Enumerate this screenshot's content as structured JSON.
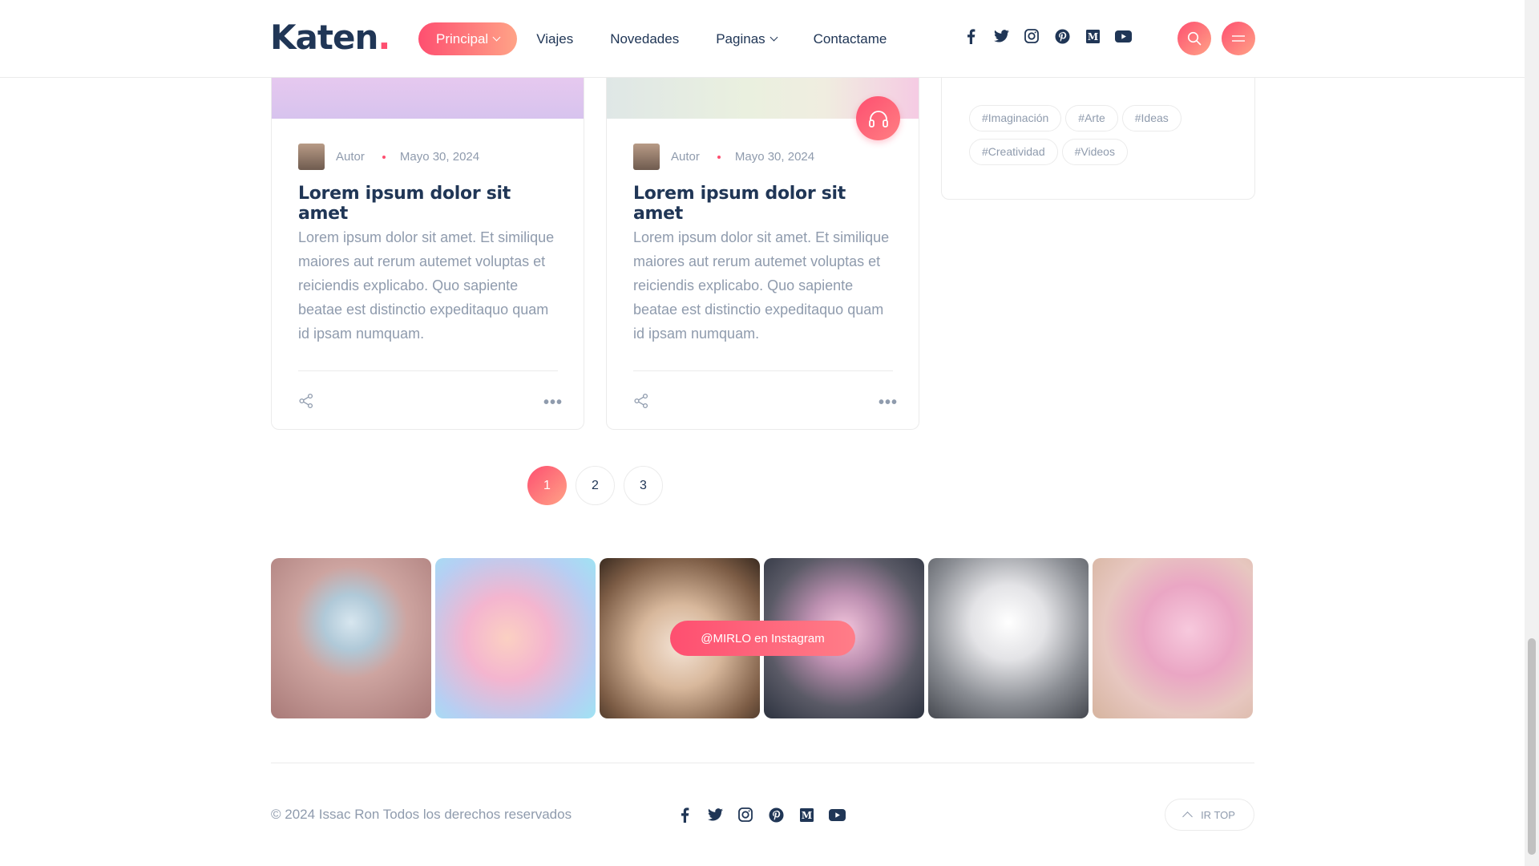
{
  "header": {
    "logo": "Katen",
    "logo_dot": ".",
    "nav": [
      {
        "label": "Principal",
        "active": true,
        "dropdown": true
      },
      {
        "label": "Viajes"
      },
      {
        "label": "Novedades"
      },
      {
        "label": "Paginas",
        "dropdown": true
      },
      {
        "label": "Contactame"
      }
    ],
    "social_icons": [
      "facebook-icon",
      "twitter-icon",
      "instagram-icon",
      "pinterest-icon",
      "medium-icon",
      "youtube-icon"
    ],
    "actions": [
      "search-icon",
      "menu-icon"
    ]
  },
  "posts": [
    {
      "author": "Autor",
      "date": "Mayo 30, 2024",
      "title": "Lorem ipsum dolor sit amet",
      "excerpt": "Lorem ipsum dolor sit amet. Et similique maiores aut rerum autemet voluptas et reiciendis explicabo. Quo sapiente beatae est distinctio expeditaquo quam id ipsam numquam."
    },
    {
      "author": "Autor",
      "date": "Mayo 30, 2024",
      "title": "Lorem ipsum dolor sit amet",
      "excerpt": "Lorem ipsum dolor sit amet. Et similique maiores aut rerum autemet voluptas et reiciendis explicabo. Quo sapiente beatae est distinctio expeditaquo quam id ipsam numquam.",
      "badge_icon": "headphones-icon"
    }
  ],
  "tags": [
    "#Imaginación",
    "#Arte",
    "#Ideas",
    "#Creatividad",
    "#Videos"
  ],
  "pagination": {
    "pages": [
      "1",
      "2",
      "3"
    ],
    "current": "1"
  },
  "instagram": {
    "button_label": "@MIRLO en Instagram",
    "tiles": [
      "kitten-in-teacup-image",
      "kitten-in-sneaker-image",
      "kitten-in-sweater-image",
      "cat-in-pink-outfit-image",
      "cat-on-phone-image",
      "cat-selfie-image"
    ]
  },
  "footer": {
    "copyright": "© 2024 Issac Ron Todos los derechos reservados",
    "top_label": "IR TOP"
  },
  "colors": {
    "accent": "#fe4f70",
    "accent_light": "#ffa387",
    "heading": "#203656",
    "text": "#8f9bad",
    "border": "#ebebeb"
  }
}
